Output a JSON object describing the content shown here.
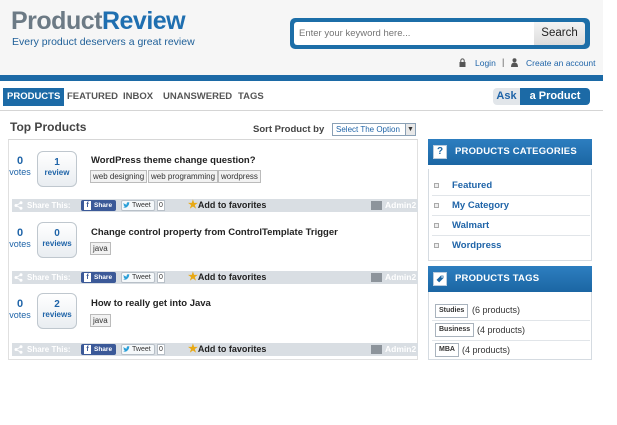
{
  "header": {
    "logo_part1": "Product",
    "logo_part2": "Review",
    "tagline": "Every product deservers a great review",
    "search_placeholder": "Enter your keyword here...",
    "search_button": "Search",
    "login": "Login",
    "separator": "|",
    "create_account": "Create an account"
  },
  "nav": {
    "items": [
      "PRODUCTS",
      "FEATURED",
      "INBOX",
      "UNANSWERED",
      "TAGS"
    ],
    "active": "PRODUCTS",
    "ask_part1": "Ask",
    "ask_part2": "a Product"
  },
  "main": {
    "title": "Top Products",
    "sort_label": "Sort Product by",
    "sort_value": "Select The Option"
  },
  "share": {
    "label": "Share This:",
    "fb": "Share",
    "tweet": "Tweet",
    "favorite": "Add to favorites"
  },
  "questions": [
    {
      "votes": "0",
      "votes_label": "votes",
      "reviews": "1",
      "reviews_label": "review",
      "title": "WordPress theme change question?",
      "tags": [
        "web designing",
        "web programming",
        "wordpress"
      ],
      "tweet_count": "0",
      "author": "Admin2"
    },
    {
      "votes": "0",
      "votes_label": "votes",
      "reviews": "0",
      "reviews_label": "reviews",
      "title": "Change control property from ControlTemplate Trigger",
      "tags": [
        "java"
      ],
      "tweet_count": "0",
      "author": "Admin2"
    },
    {
      "votes": "0",
      "votes_label": "votes",
      "reviews": "2",
      "reviews_label": "reviews",
      "title": "How to really get into Java",
      "tags": [
        "java"
      ],
      "tweet_count": "0",
      "author": "Admin2"
    }
  ],
  "sidebar": {
    "categories_title": "PRODUCTS CATEGORIES",
    "categories": [
      "Featured",
      "My Category",
      "Walmart",
      "Wordpress"
    ],
    "tags_title": "PRODUCTS TAGS",
    "tags": [
      {
        "name": "Studies",
        "count": "(6 products)"
      },
      {
        "name": "Business",
        "count": "(4 products)"
      },
      {
        "name": "MBA",
        "count": "(4 products)"
      }
    ]
  },
  "colors": {
    "brand_blue": "#1c6aa6",
    "link_blue": "#1f64a8",
    "share_bar": "#d9dee3",
    "star": "#e8a915"
  }
}
